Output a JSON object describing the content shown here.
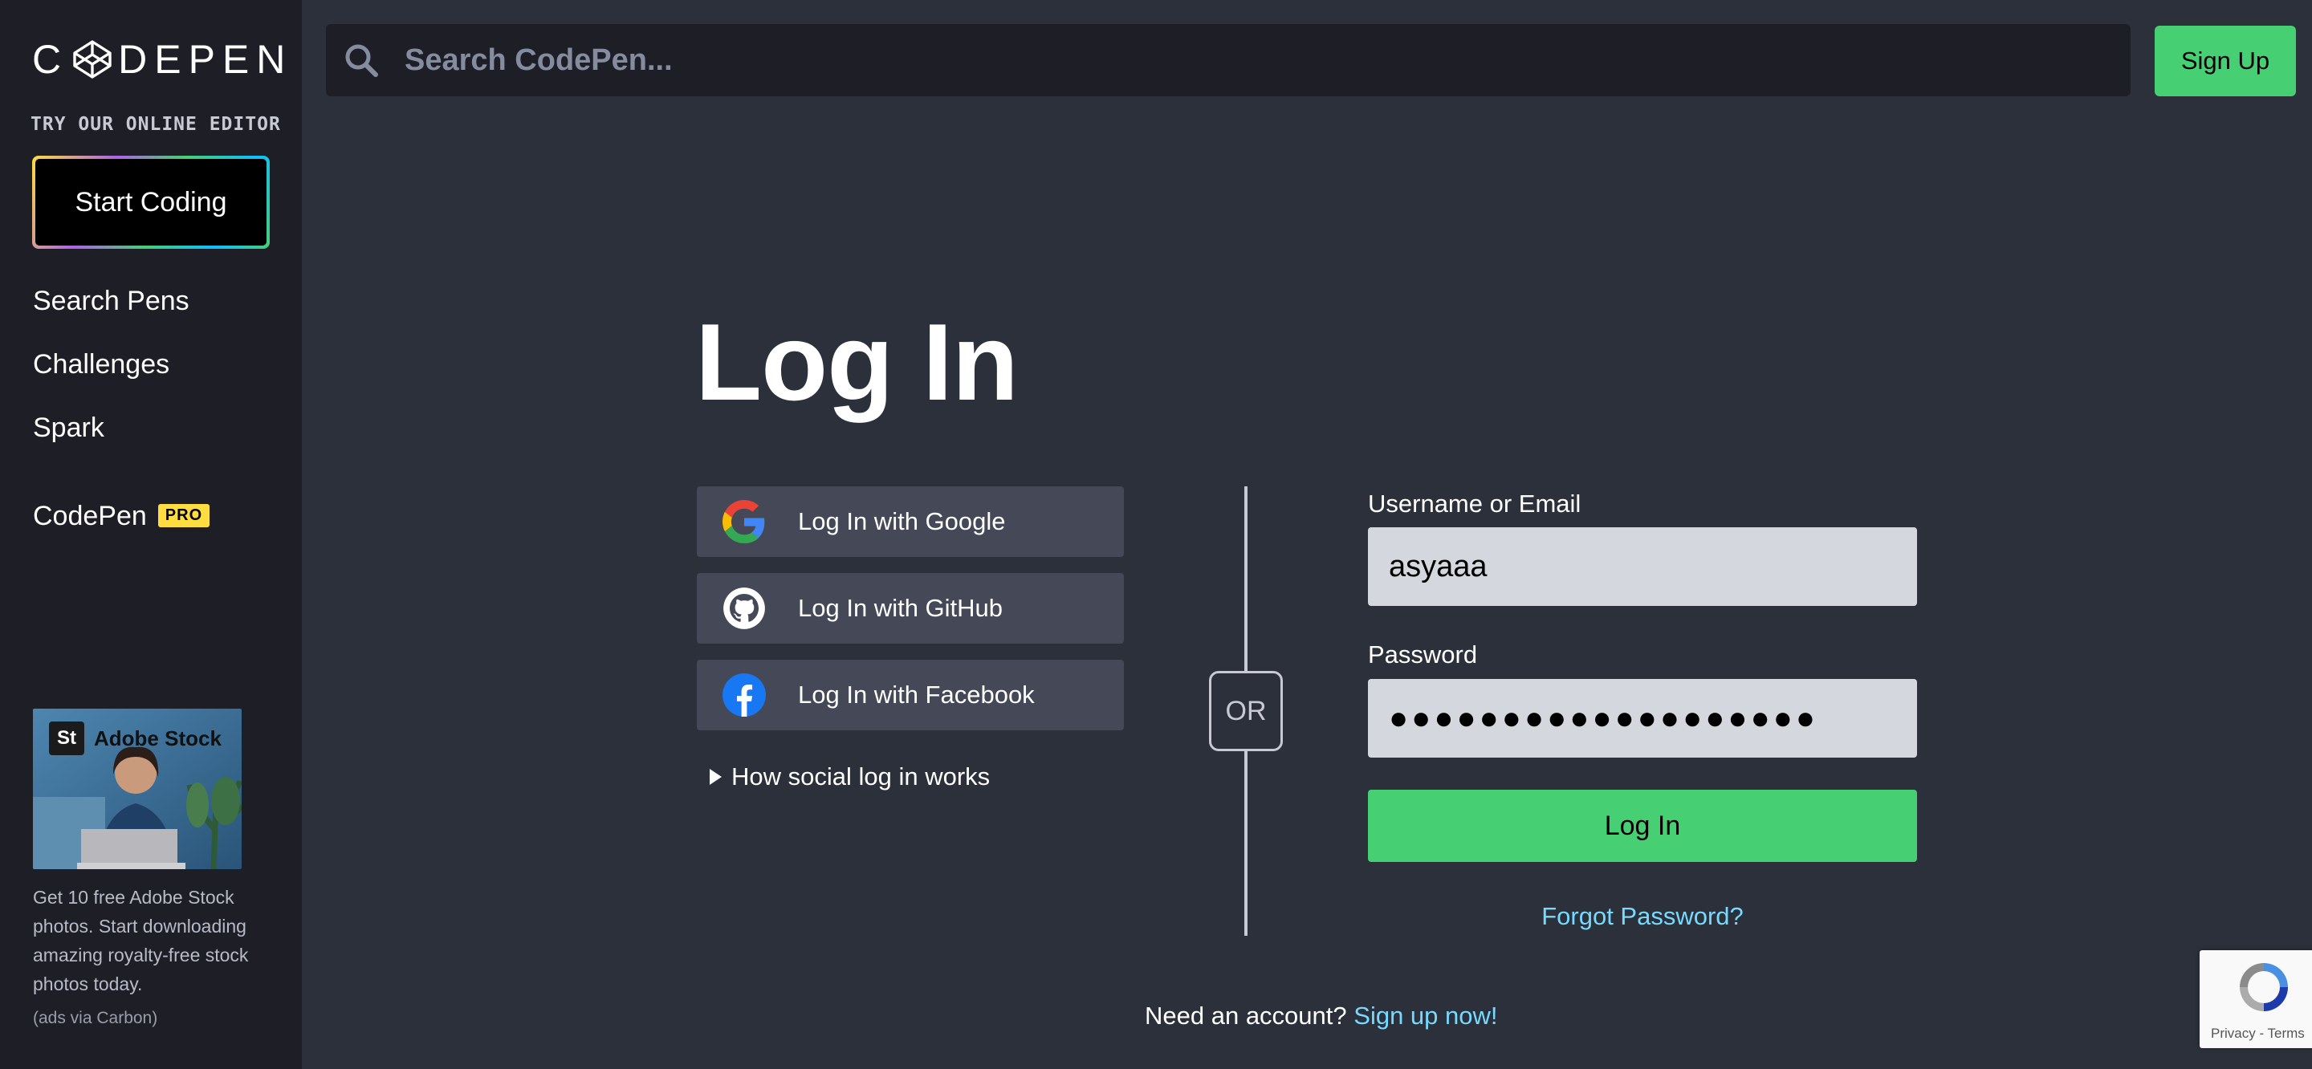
{
  "sidebar": {
    "logo_text": "CODEPEN",
    "logo_letters": {
      "first": "C",
      "rest": "DEPEN"
    },
    "try_label": "TRY OUR ONLINE EDITOR",
    "start_coding_label": "Start Coding",
    "nav": [
      {
        "label": "Search Pens"
      },
      {
        "label": "Challenges"
      },
      {
        "label": "Spark"
      }
    ],
    "codepen_pro": {
      "label": "CodePen",
      "badge": "PRO"
    },
    "ad": {
      "brand_badge": "St",
      "brand_name": "Adobe Stock",
      "text": "Get 10 free Adobe Stock photos. Start downloading amazing royalty-free stock photos today.",
      "via": "(ads via Carbon)"
    }
  },
  "header": {
    "search_placeholder": "Search CodePen...",
    "signup_label": "Sign Up"
  },
  "login": {
    "title": "Log In",
    "social": [
      {
        "label": "Log In with Google",
        "icon": "google-icon"
      },
      {
        "label": "Log In with GitHub",
        "icon": "github-icon"
      },
      {
        "label": "Log In with Facebook",
        "icon": "facebook-icon"
      }
    ],
    "how_social": "How social log in works",
    "or_label": "OR",
    "username_label": "Username or Email",
    "username_value": "asyaaa",
    "password_label": "Password",
    "password_value": "●●●●●●●●●●●●●●●●●●●",
    "submit_label": "Log In",
    "forgot_label": "Forgot Password?",
    "need_account": "Need an account?",
    "signup_now": "Sign up now!"
  },
  "recaptcha": {
    "links": "Privacy - Terms"
  },
  "colors": {
    "background": "#2c303a",
    "sidebar": "#1e1f26",
    "accent_green": "#47cf73",
    "link_blue": "#76daff",
    "pro_yellow": "#ffdd40",
    "social_button": "#444857"
  }
}
